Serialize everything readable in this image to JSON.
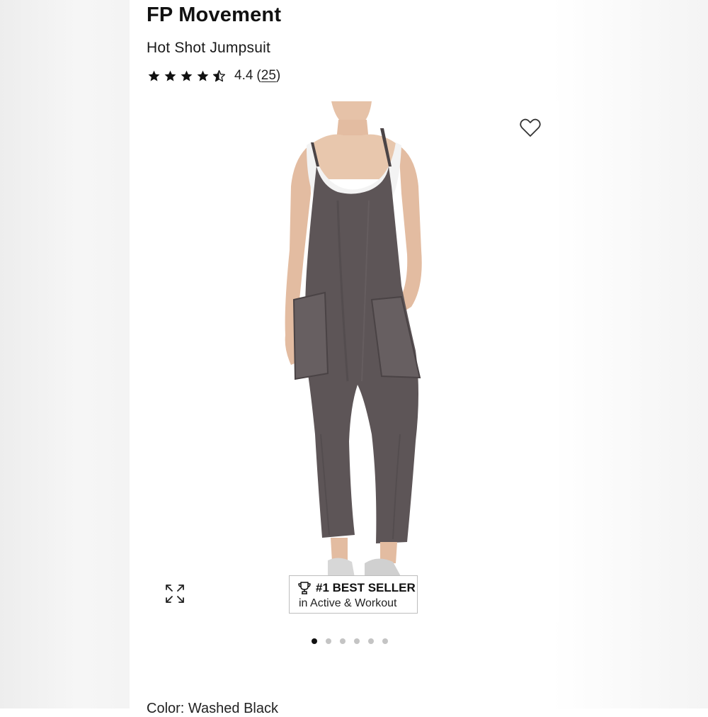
{
  "product": {
    "brand": "FP Movement",
    "name": "Hot Shot Jumpsuit",
    "rating_value": "4.4",
    "review_open": "(",
    "review_count": "25",
    "review_close": ")",
    "rating_stars": 4.4,
    "stars_max": 5
  },
  "gallery": {
    "favorite_icon": "heart-outline-icon",
    "expand_icon": "expand-arrows-icon",
    "dots_total": 6,
    "active_dot": 1
  },
  "badge": {
    "icon": "trophy-icon",
    "line1": "#1 BEST SELLER",
    "line2": "in Active & Workout"
  },
  "color": {
    "label": "Color: Washed Black"
  },
  "colors": {
    "fabric": "#5d5557",
    "text": "#111111",
    "dot_inactive": "#c4c4c4"
  }
}
